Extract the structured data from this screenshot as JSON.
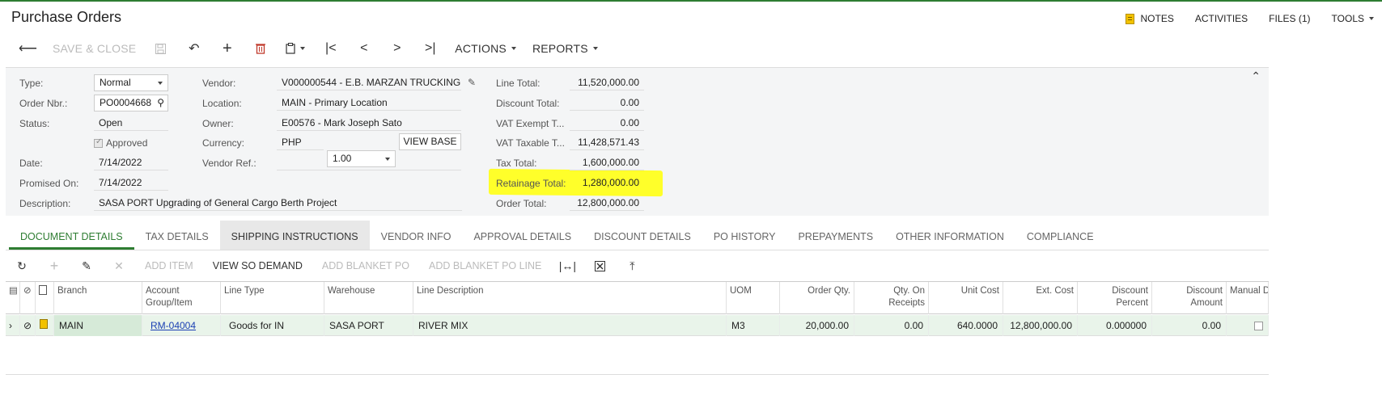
{
  "screen": {
    "title": "Purchase Orders",
    "toplinks": [
      "NOTES",
      "ACTIVITIES",
      "FILES (1)",
      "TOOLS"
    ],
    "toolbar": {
      "back_icon": "↩",
      "save_close": "SAVE & CLOSE",
      "actions": "ACTIONS",
      "reports": "REPORTS"
    }
  },
  "form": {
    "labels": {
      "type": "Type:",
      "order_nbr": "Order Nbr.:",
      "status": "Status:",
      "date": "Date:",
      "promised_on": "Promised On:",
      "description": "Description:",
      "vendor": "Vendor:",
      "location": "Location:",
      "owner": "Owner:",
      "currency": "Currency:",
      "vendor_ref": "Vendor Ref.:",
      "line_total": "Line Total:",
      "discount_total": "Discount Total:",
      "vat_exempt": "VAT Exempt T...",
      "vat_taxable": "VAT Taxable T...",
      "tax_total": "Tax Total:",
      "retainage_total": "Retainage Total:",
      "order_total": "Order Total:"
    },
    "values": {
      "type": "Normal",
      "order_nbr": "PO0004668",
      "status": "Open",
      "approved_label": "Approved",
      "approved": true,
      "date": "7/14/2022",
      "promised_on": "7/14/2022",
      "description": "SASA PORT Upgrading of General Cargo Berth Project",
      "vendor": "V000000544 - E.B. MARZAN TRUCKING",
      "location": "MAIN - Primary Location",
      "owner": "E00576 - Mark Joseph Sato",
      "currency": "PHP",
      "rate": "1.00",
      "view_base": "VIEW BASE",
      "vendor_ref": "",
      "line_total": "11,520,000.00",
      "discount_total": "0.00",
      "vat_exempt": "0.00",
      "vat_taxable": "11,428,571.43",
      "tax_total": "1,600,000.00",
      "retainage_total": "1,280,000.00",
      "order_total": "12,800,000.00"
    },
    "highlight_color": "#ffff2a"
  },
  "tabs": [
    {
      "label": "DOCUMENT DETAILS"
    },
    {
      "label": "TAX DETAILS"
    },
    {
      "label": "SHIPPING INSTRUCTIONS"
    },
    {
      "label": "VENDOR INFO"
    },
    {
      "label": "APPROVAL DETAILS"
    },
    {
      "label": "DISCOUNT DETAILS"
    },
    {
      "label": "PO HISTORY"
    },
    {
      "label": "PREPAYMENTS"
    },
    {
      "label": "OTHER INFORMATION"
    },
    {
      "label": "COMPLIANCE"
    }
  ],
  "grid_toolbar": {
    "add_item": "ADD ITEM",
    "view_so_demand": "VIEW SO DEMAND",
    "add_blanket_po": "ADD BLANKET PO",
    "add_blanket_po_line": "ADD BLANKET PO LINE"
  },
  "grid": {
    "columns": {
      "branch": "Branch",
      "account_group_item": "Account Group/Item",
      "line_type": "Line Type",
      "warehouse": "Warehouse",
      "line_description": "Line Description",
      "uom": "UOM",
      "order_qty": "Order Qty.",
      "qty_on_receipts": "Qty. On Receipts",
      "unit_cost": "Unit Cost",
      "ext_cost": "Ext. Cost",
      "discount_percent": "Discount Percent",
      "discount_amount": "Discount Amount",
      "manual_discount": "Manual Discoun"
    },
    "rows": [
      {
        "branch": "MAIN",
        "account_group_item": "RM-04004",
        "line_type": "Goods for IN",
        "warehouse": "SASA PORT",
        "line_description": "RIVER MIX",
        "uom": "M3",
        "order_qty": "20,000.00",
        "qty_on_receipts": "0.00",
        "unit_cost": "640.0000",
        "ext_cost": "12,800,000.00",
        "discount_percent": "0.000000",
        "discount_amount": "0.00",
        "manual_discount": false
      }
    ]
  }
}
